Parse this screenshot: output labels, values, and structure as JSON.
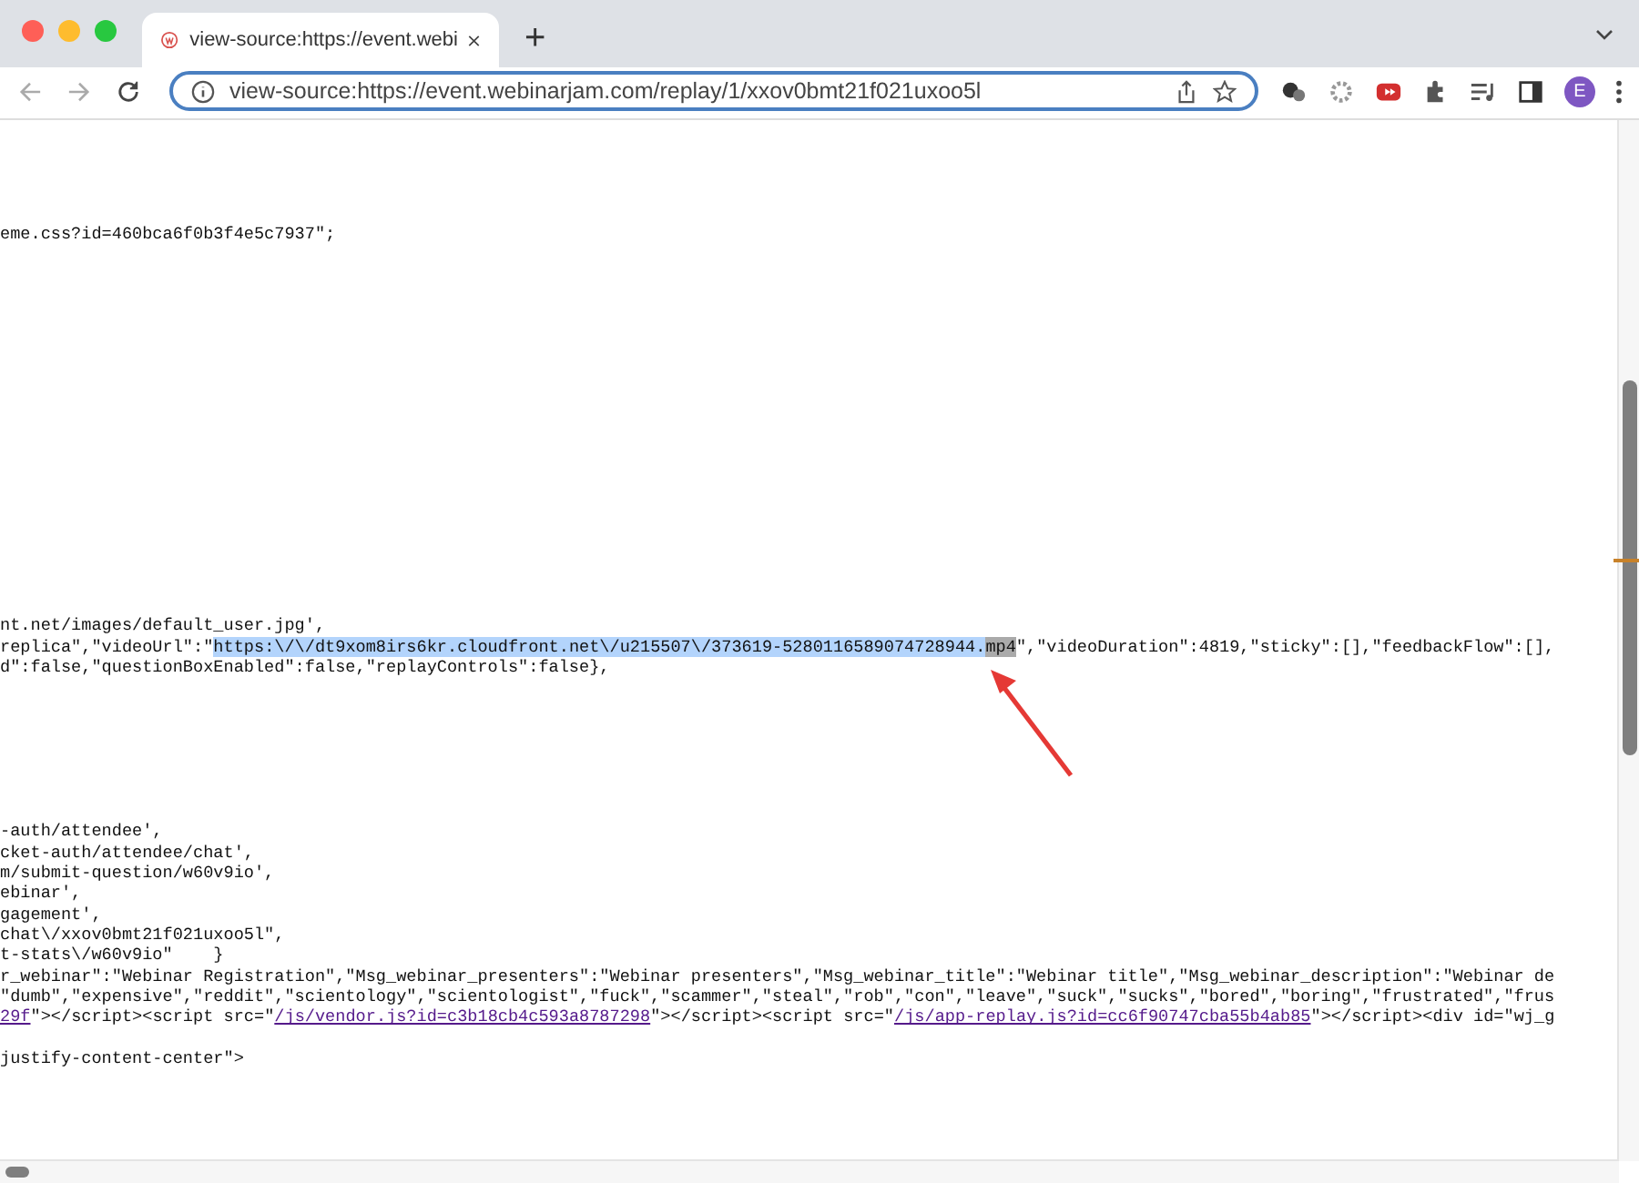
{
  "tab": {
    "title": "view-source:https://event.webi",
    "selected": true
  },
  "new_tab": "+",
  "address_bar": {
    "value": "view-source:https://event.webinarjam.com/replay/1/xxov0bmt21f021uxoo5l"
  },
  "profile": "E",
  "source_blocks": [
    {
      "lines": [
        [
          {
            "kind": "text",
            "text": "eme.css?id=460bca6f0b3f4e5c7937\";"
          }
        ]
      ]
    },
    {
      "lines": [
        [
          {
            "kind": "text",
            "text": "nt.net/images/default_user.jpg',"
          }
        ],
        [
          {
            "kind": "text",
            "text": "replica\",\"videoUrl\":\""
          },
          {
            "kind": "selected",
            "text": "https:\\/\\/dt9xom8irs6kr.cloudfront.net\\/u215507\\/373619-5280116589074728944."
          },
          {
            "kind": "match",
            "text": "mp4"
          },
          {
            "kind": "text",
            "text": "\",\"videoDuration\":4819,\"sticky\":[],\"feedbackFlow\":[],"
          }
        ],
        [
          {
            "kind": "text",
            "text": "d\":false,\"questionBoxEnabled\":false,\"replayControls\":false},"
          }
        ]
      ]
    },
    {
      "lines": [
        [
          {
            "kind": "text",
            "text": "-auth/attendee',"
          }
        ],
        [
          {
            "kind": "text",
            "text": "cket-auth/attendee/chat',"
          }
        ],
        [
          {
            "kind": "text",
            "text": "m/submit-question/w60v9io',"
          }
        ],
        [
          {
            "kind": "text",
            "text": "ebinar',"
          }
        ],
        [
          {
            "kind": "text",
            "text": "gagement',"
          }
        ],
        [
          {
            "kind": "text",
            "text": "chat\\/xxov0bmt21f021uxoo5l\","
          }
        ],
        [
          {
            "kind": "text",
            "text": "t-stats\\/w60v9io\"    }"
          }
        ],
        [
          {
            "kind": "text",
            "text": "r_webinar\":\"Webinar Registration\",\"Msg_webinar_presenters\":\"Webinar presenters\",\"Msg_webinar_title\":\"Webinar title\",\"Msg_webinar_description\":\"Webinar de"
          }
        ],
        [
          {
            "kind": "text",
            "text": "\"dumb\",\"expensive\",\"reddit\",\"scientology\",\"scientologist\",\"fuck\",\"scammer\",\"steal\",\"rob\",\"con\",\"leave\",\"suck\",\"sucks\",\"bored\",\"boring\",\"frustrated\",\"frus"
          }
        ],
        [
          {
            "kind": "link",
            "text": "29f"
          },
          {
            "kind": "text",
            "text": "\"></script><script src=\""
          },
          {
            "kind": "link",
            "text": "/js/vendor.js?id=c3b18cb4c593a8787298"
          },
          {
            "kind": "text",
            "text": "\"></script><script src=\""
          },
          {
            "kind": "link",
            "text": "/js/app-replay.js?id=cc6f90747cba55b4ab85"
          },
          {
            "kind": "text",
            "text": "\"></script><div id=\"wj_g"
          }
        ]
      ]
    },
    {
      "lines": [
        [
          {
            "kind": "text",
            "text": "justify-content-center\">"
          }
        ]
      ]
    }
  ]
}
